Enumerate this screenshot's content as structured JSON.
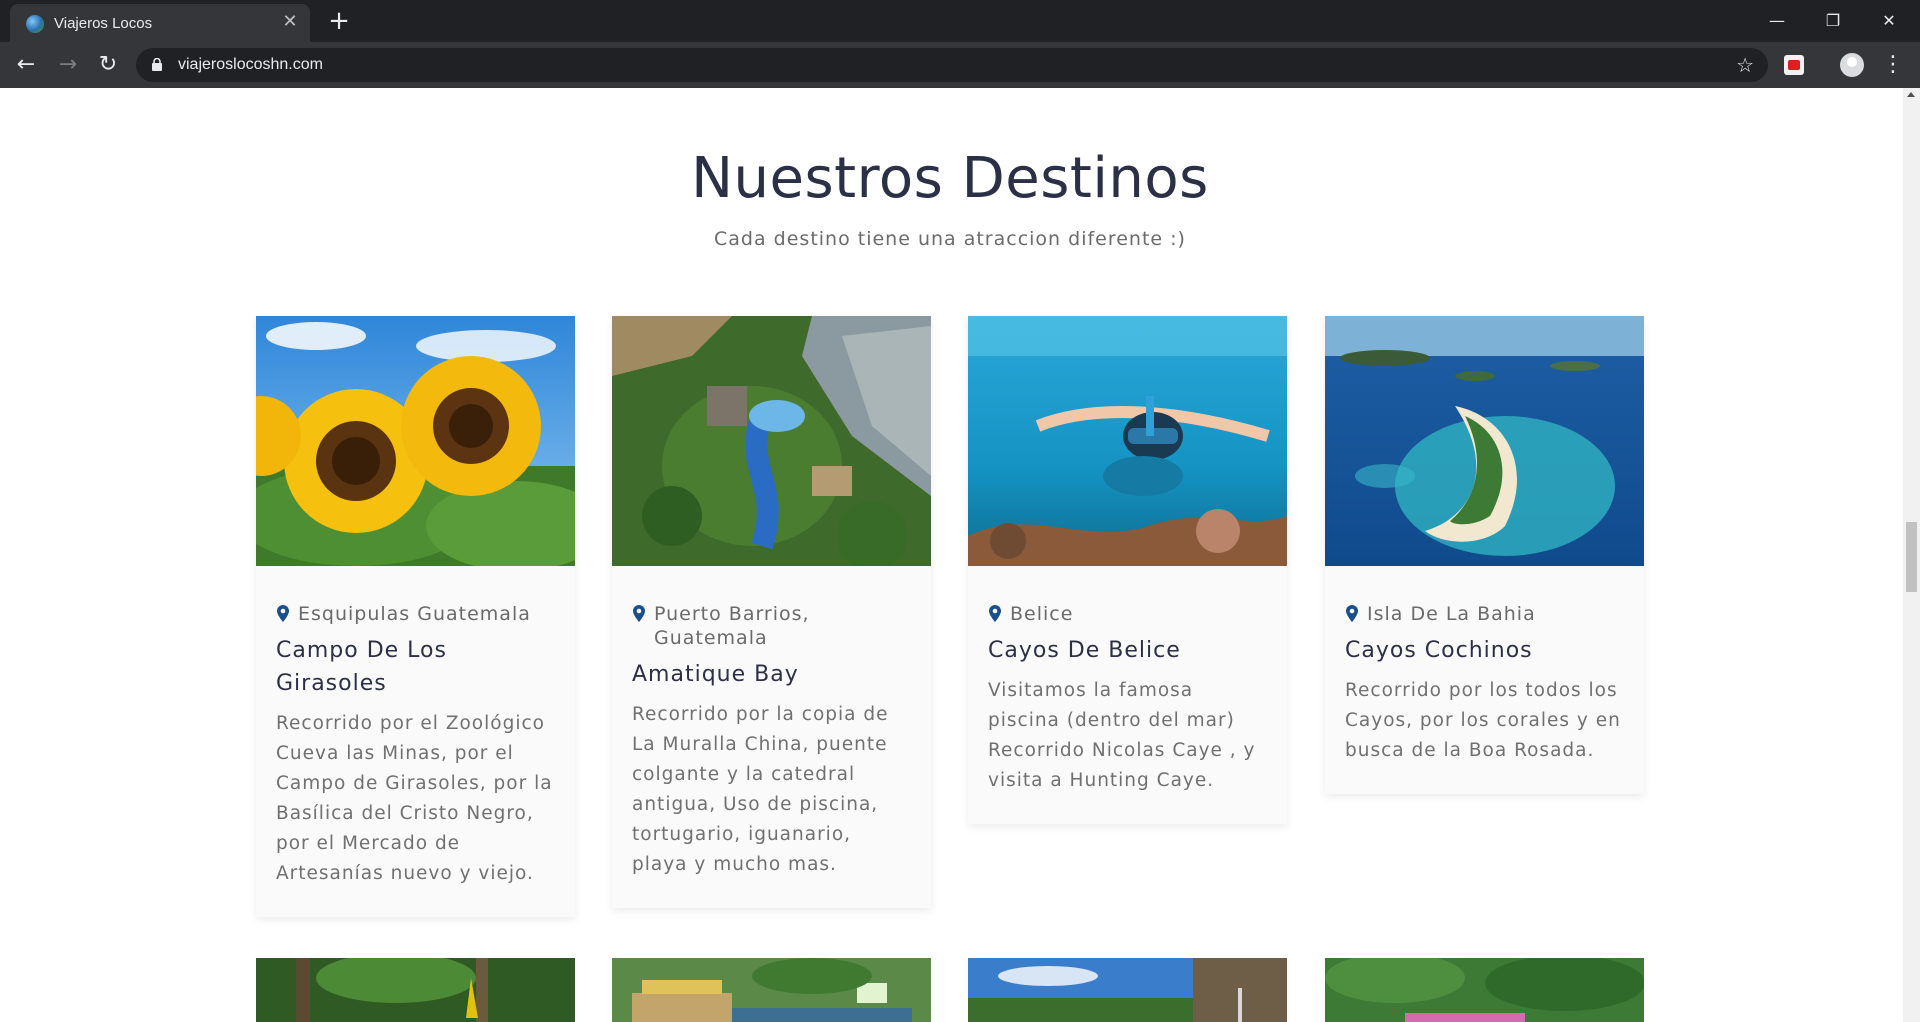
{
  "browser": {
    "tab_title": "Viajeros Locos",
    "url": "viajeroslocoshn.com"
  },
  "section": {
    "title": "Nuestros Destinos",
    "subtitle": "Cada destino tiene una atraccion diferente :)"
  },
  "destinations": [
    {
      "location": "Esquipulas Guatemala",
      "title": "Campo De Los Girasoles",
      "description": "Recorrido por el Zoológico Cueva las Minas, por el Campo de Girasoles, por la Basílica del Cristo Negro, por el Mercado de Artesanías nuevo y viejo.",
      "image": "sunflowers"
    },
    {
      "location": "Puerto Barrios, Guatemala",
      "title": "Amatique Bay",
      "description": "Recorrido por la copia de La Muralla China, puente colgante y la catedral antigua, Uso de piscina, tortugario, iguanario, playa y mucho mas.",
      "image": "resort-aerial"
    },
    {
      "location": " Belice",
      "title": "Cayos De Belice",
      "description": "Visitamos la famosa piscina (dentro del mar) Recorrido Nicolas Caye , y visita a Hunting Caye.",
      "image": "snorkeler"
    },
    {
      "location": "Isla De La Bahia",
      "title": "Cayos Cochinos",
      "description": "Recorrido por los todos los Cayos, por los corales y en busca de la Boa Rosada.",
      "image": "island-aerial"
    }
  ],
  "colors": {
    "heading": "#2c3047",
    "pin": "#1b4f8a",
    "text": "#707070"
  }
}
